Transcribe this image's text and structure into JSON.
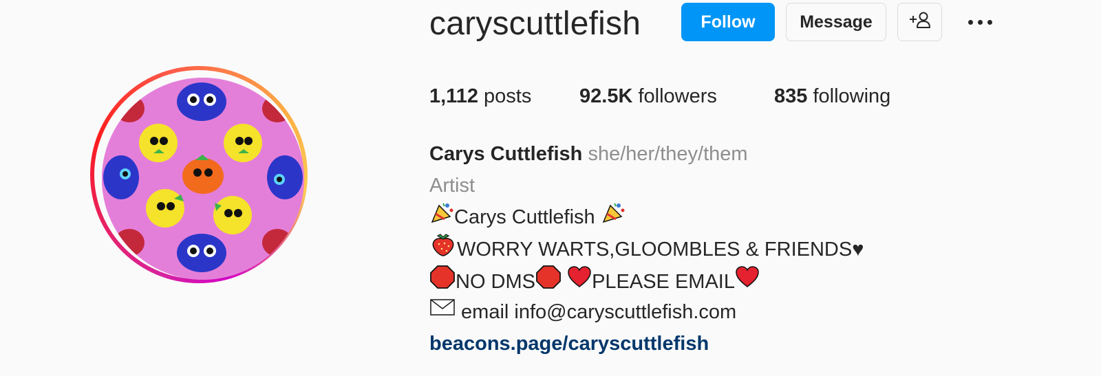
{
  "profile": {
    "username": "caryscuttlefish",
    "follow_label": "Follow",
    "message_label": "Message",
    "suggest_icon": "add-person-icon",
    "more_icon": "more-options-icon"
  },
  "stats": {
    "posts_count": "1,112",
    "posts_label": " posts",
    "followers_count": "92.5K",
    "followers_label": " followers",
    "following_count": "835",
    "following_label": " following"
  },
  "bio": {
    "full_name": "Carys Cuttlefish",
    "pronouns": "she/her/they/them",
    "category": "Artist",
    "line1_text": "Carys Cuttlefish ",
    "line2_text": "WORRY WARTS,GLOOMBLES & FRIENDS",
    "line2_suffix": "♥",
    "line3_a": "NO DMS",
    "line3_b": "PLEASE EMAIL",
    "line4_text": " email info@caryscuttlefish.com",
    "link": "beacons.page/caryscuttlefish"
  },
  "colors": {
    "accent": "#0095f6",
    "link": "#00376b",
    "muted": "#8e8e8e"
  },
  "icons": [
    "party-popper-icon",
    "strawberry-icon",
    "stop-sign-icon",
    "red-heart-icon",
    "envelope-icon"
  ]
}
